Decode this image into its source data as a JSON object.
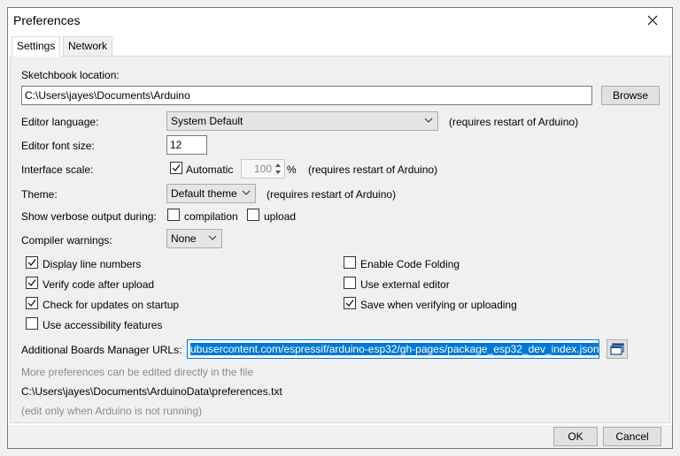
{
  "window": {
    "title": "Preferences",
    "close_glyph": "×"
  },
  "tabs": [
    {
      "label": "Settings"
    },
    {
      "label": "Network"
    }
  ],
  "sketchbook": {
    "label": "Sketchbook location:",
    "value": "C:\\Users\\jayes\\Documents\\Arduino",
    "browse_label": "Browse"
  },
  "editor_language": {
    "label": "Editor language:",
    "value": "System Default",
    "note": "(requires restart of Arduino)"
  },
  "editor_font_size": {
    "label": "Editor font size:",
    "value": "12"
  },
  "interface_scale": {
    "label": "Interface scale:",
    "automatic_label": "Automatic",
    "automatic_checked": true,
    "value": "100",
    "unit": "%",
    "note": "(requires restart of Arduino)"
  },
  "theme": {
    "label": "Theme:",
    "value": "Default theme",
    "note": "(requires restart of Arduino)"
  },
  "verbose": {
    "label": "Show verbose output during:",
    "compilation_label": "compilation",
    "compilation_checked": false,
    "upload_label": "upload",
    "upload_checked": false
  },
  "compiler_warnings": {
    "label": "Compiler warnings:",
    "value": "None"
  },
  "options_left": [
    {
      "label": "Display line numbers",
      "checked": true
    },
    {
      "label": "Verify code after upload",
      "checked": true
    },
    {
      "label": "Check for updates on startup",
      "checked": true
    },
    {
      "label": "Use accessibility features",
      "checked": false
    }
  ],
  "options_right": [
    {
      "label": "Enable Code Folding",
      "checked": false
    },
    {
      "label": "Use external editor",
      "checked": false
    },
    {
      "label": "Save when verifying or uploading",
      "checked": true
    }
  ],
  "boards_manager": {
    "label": "Additional Boards Manager URLs:",
    "value": "ubusercontent.com/espressif/arduino-esp32/gh-pages/package_esp32_dev_index.json"
  },
  "more_prefs_note": "More preferences can be edited directly in the file",
  "prefs_path": "C:\\Users\\jayes\\Documents\\ArduinoData\\preferences.txt",
  "edit_note": "(edit only when Arduino is not running)",
  "footer": {
    "ok_label": "OK",
    "cancel_label": "Cancel"
  },
  "colors": {
    "selection": "#0078d7",
    "window_bg": "#f0f0f0",
    "muted_text": "#8a8a8a"
  },
  "icons": {
    "close": "close-icon",
    "dropdown": "chevron-down-icon",
    "spinner": "spinner-arrows-icon",
    "checkmark": "checkmark-icon",
    "url_editor": "window-edit-icon"
  }
}
